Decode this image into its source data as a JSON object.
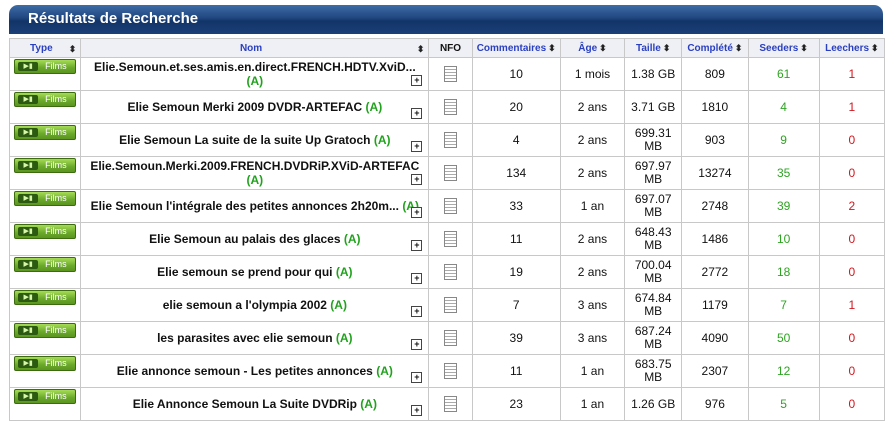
{
  "title": "Résultats de Recherche",
  "columns": {
    "type": "Type",
    "name": "Nom",
    "nfo": "NFO",
    "comments": "Commentaires",
    "age": "Âge",
    "size": "Taille",
    "completed": "Complété",
    "seeders": "Seeders",
    "leechers": "Leechers"
  },
  "rows": [
    {
      "type": "Films",
      "name": "Elie.Semoun.et.ses.amis.en.direct.FRENCH.HDTV.XviD...",
      "flag": "(A)",
      "comments": "10",
      "age": "1 mois",
      "size": "1.38 GB",
      "completed": "809",
      "seeders": "61",
      "leechers": "1"
    },
    {
      "type": "Films",
      "name": "Elie Semoun Merki 2009 DVDR-ARTEFAC",
      "flag": "(A)",
      "comments": "20",
      "age": "2 ans",
      "size": "3.71 GB",
      "completed": "1810",
      "seeders": "4",
      "leechers": "1"
    },
    {
      "type": "Films",
      "name": "Elie Semoun La suite de la suite Up Gratoch",
      "flag": "(A)",
      "comments": "4",
      "age": "2 ans",
      "size": "699.31 MB",
      "completed": "903",
      "seeders": "9",
      "leechers": "0"
    },
    {
      "type": "Films",
      "name": "Elie.Semoun.Merki.2009.FRENCH.DVDRiP.XViD-ARTEFAC",
      "flag": "(A)",
      "comments": "134",
      "age": "2 ans",
      "size": "697.97 MB",
      "completed": "13274",
      "seeders": "35",
      "leechers": "0"
    },
    {
      "type": "Films",
      "name": "Elie Semoun l'intégrale des petites annonces 2h20m...",
      "flag": "(A)",
      "comments": "33",
      "age": "1 an",
      "size": "697.07 MB",
      "completed": "2748",
      "seeders": "39",
      "leechers": "2"
    },
    {
      "type": "Films",
      "name": "Elie Semoun au palais des glaces",
      "flag": "(A)",
      "comments": "11",
      "age": "2 ans",
      "size": "648.43 MB",
      "completed": "1486",
      "seeders": "10",
      "leechers": "0"
    },
    {
      "type": "Films",
      "name": "Elie semoun se prend pour qui",
      "flag": "(A)",
      "comments": "19",
      "age": "2 ans",
      "size": "700.04 MB",
      "completed": "2772",
      "seeders": "18",
      "leechers": "0"
    },
    {
      "type": "Films",
      "name": "elie semoun a l'olympia 2002",
      "flag": "(A)",
      "comments": "7",
      "age": "3 ans",
      "size": "674.84 MB",
      "completed": "1179",
      "seeders": "7",
      "leechers": "1"
    },
    {
      "type": "Films",
      "name": "les parasites avec elie semoun",
      "flag": "(A)",
      "comments": "39",
      "age": "3 ans",
      "size": "687.24 MB",
      "completed": "4090",
      "seeders": "50",
      "leechers": "0"
    },
    {
      "type": "Films",
      "name": "Elie annonce semoun - Les petites annonces",
      "flag": "(A)",
      "comments": "11",
      "age": "1 an",
      "size": "683.75 MB",
      "completed": "2307",
      "seeders": "12",
      "leechers": "0"
    },
    {
      "type": "Films",
      "name": "Elie Annonce Semoun La Suite DVDRip",
      "flag": "(A)",
      "comments": "23",
      "age": "1 an",
      "size": "1.26 GB",
      "completed": "976",
      "seeders": "5",
      "leechers": "0"
    }
  ],
  "icons": {
    "sort": "sort-arrows-icon",
    "plus": "plus-box-icon",
    "nfo": "document-icon",
    "category": "film-reel-icon"
  },
  "colors": {
    "header_bar": "#20467f",
    "column_header_text": "#2a3fbf",
    "seeders": "#2fa323",
    "leechers": "#d0171e",
    "flag": "#21a21d",
    "category_button": "#6aa82b"
  }
}
